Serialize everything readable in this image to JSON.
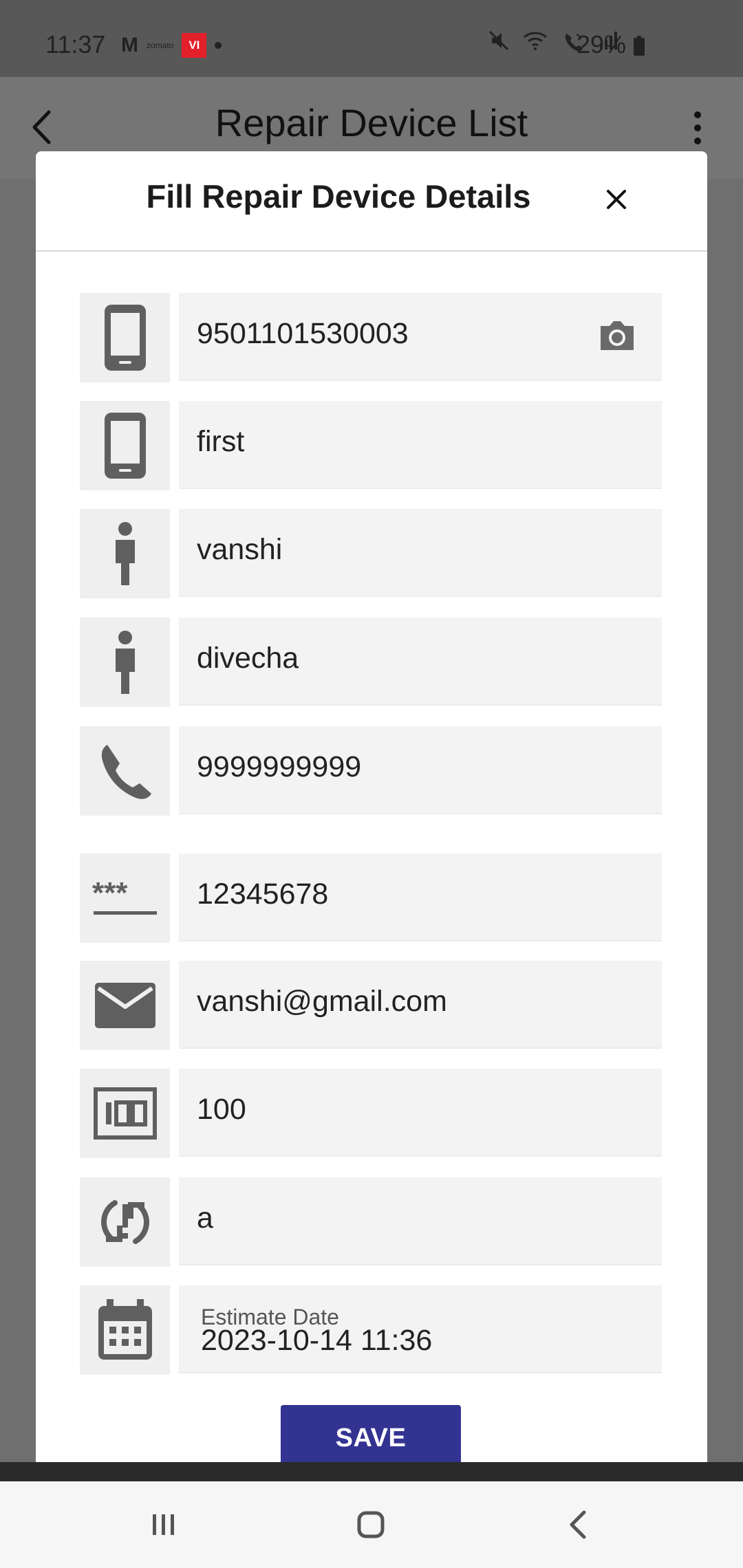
{
  "status_bar": {
    "time": "11:37",
    "mail_glyph": "M",
    "zomato_label": "zomato",
    "vi_label": "VI",
    "battery_text": "29%"
  },
  "app_bar": {
    "title": "Repair Device List"
  },
  "modal": {
    "title": "Fill Repair Device Details",
    "fields": [
      {
        "icon": "mobile-phone-icon",
        "value": "9501101530003",
        "has_camera": true
      },
      {
        "icon": "mobile-phone-icon",
        "value": "first"
      },
      {
        "icon": "person-icon",
        "value": "vanshi"
      },
      {
        "icon": "person-icon",
        "value": "divecha"
      },
      {
        "icon": "phone-icon",
        "value": "9999999999"
      },
      {
        "icon": "password-icon",
        "value": "12345678"
      },
      {
        "icon": "email-icon",
        "value": "vanshi@gmail.com"
      },
      {
        "icon": "amount-icon",
        "value": "100"
      },
      {
        "icon": "sync-problem-icon",
        "value": "a"
      },
      {
        "icon": "calendar-icon",
        "label": "Estimate Date",
        "value": "2023-10-14 11:36"
      }
    ],
    "save_label": "SAVE"
  },
  "nav_bar": {
    "recent_icon": "recent-apps-icon",
    "home_icon": "home-icon",
    "back_icon": "back-icon"
  },
  "colors": {
    "primary_button": "#333391",
    "overlay": "#6f6f6f",
    "field_background": "#f3f3f3"
  }
}
